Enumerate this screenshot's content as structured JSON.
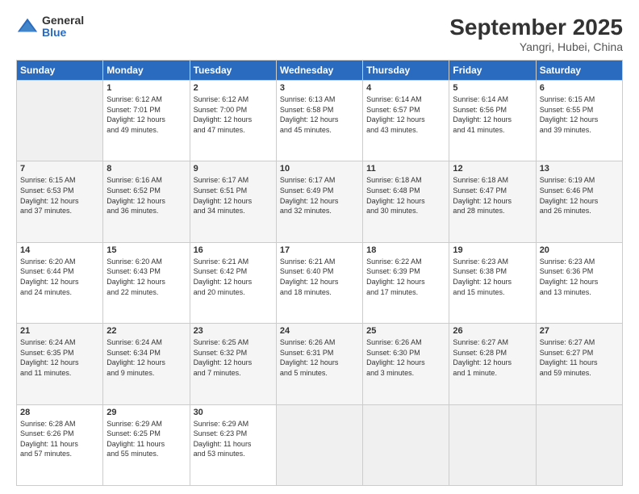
{
  "header": {
    "logo_general": "General",
    "logo_blue": "Blue",
    "month_title": "September 2025",
    "location": "Yangri, Hubei, China"
  },
  "days_of_week": [
    "Sunday",
    "Monday",
    "Tuesday",
    "Wednesday",
    "Thursday",
    "Friday",
    "Saturday"
  ],
  "weeks": [
    [
      {
        "day": "",
        "info": ""
      },
      {
        "day": "1",
        "info": "Sunrise: 6:12 AM\nSunset: 7:01 PM\nDaylight: 12 hours\nand 49 minutes."
      },
      {
        "day": "2",
        "info": "Sunrise: 6:12 AM\nSunset: 7:00 PM\nDaylight: 12 hours\nand 47 minutes."
      },
      {
        "day": "3",
        "info": "Sunrise: 6:13 AM\nSunset: 6:58 PM\nDaylight: 12 hours\nand 45 minutes."
      },
      {
        "day": "4",
        "info": "Sunrise: 6:14 AM\nSunset: 6:57 PM\nDaylight: 12 hours\nand 43 minutes."
      },
      {
        "day": "5",
        "info": "Sunrise: 6:14 AM\nSunset: 6:56 PM\nDaylight: 12 hours\nand 41 minutes."
      },
      {
        "day": "6",
        "info": "Sunrise: 6:15 AM\nSunset: 6:55 PM\nDaylight: 12 hours\nand 39 minutes."
      }
    ],
    [
      {
        "day": "7",
        "info": "Sunrise: 6:15 AM\nSunset: 6:53 PM\nDaylight: 12 hours\nand 37 minutes."
      },
      {
        "day": "8",
        "info": "Sunrise: 6:16 AM\nSunset: 6:52 PM\nDaylight: 12 hours\nand 36 minutes."
      },
      {
        "day": "9",
        "info": "Sunrise: 6:17 AM\nSunset: 6:51 PM\nDaylight: 12 hours\nand 34 minutes."
      },
      {
        "day": "10",
        "info": "Sunrise: 6:17 AM\nSunset: 6:49 PM\nDaylight: 12 hours\nand 32 minutes."
      },
      {
        "day": "11",
        "info": "Sunrise: 6:18 AM\nSunset: 6:48 PM\nDaylight: 12 hours\nand 30 minutes."
      },
      {
        "day": "12",
        "info": "Sunrise: 6:18 AM\nSunset: 6:47 PM\nDaylight: 12 hours\nand 28 minutes."
      },
      {
        "day": "13",
        "info": "Sunrise: 6:19 AM\nSunset: 6:46 PM\nDaylight: 12 hours\nand 26 minutes."
      }
    ],
    [
      {
        "day": "14",
        "info": "Sunrise: 6:20 AM\nSunset: 6:44 PM\nDaylight: 12 hours\nand 24 minutes."
      },
      {
        "day": "15",
        "info": "Sunrise: 6:20 AM\nSunset: 6:43 PM\nDaylight: 12 hours\nand 22 minutes."
      },
      {
        "day": "16",
        "info": "Sunrise: 6:21 AM\nSunset: 6:42 PM\nDaylight: 12 hours\nand 20 minutes."
      },
      {
        "day": "17",
        "info": "Sunrise: 6:21 AM\nSunset: 6:40 PM\nDaylight: 12 hours\nand 18 minutes."
      },
      {
        "day": "18",
        "info": "Sunrise: 6:22 AM\nSunset: 6:39 PM\nDaylight: 12 hours\nand 17 minutes."
      },
      {
        "day": "19",
        "info": "Sunrise: 6:23 AM\nSunset: 6:38 PM\nDaylight: 12 hours\nand 15 minutes."
      },
      {
        "day": "20",
        "info": "Sunrise: 6:23 AM\nSunset: 6:36 PM\nDaylight: 12 hours\nand 13 minutes."
      }
    ],
    [
      {
        "day": "21",
        "info": "Sunrise: 6:24 AM\nSunset: 6:35 PM\nDaylight: 12 hours\nand 11 minutes."
      },
      {
        "day": "22",
        "info": "Sunrise: 6:24 AM\nSunset: 6:34 PM\nDaylight: 12 hours\nand 9 minutes."
      },
      {
        "day": "23",
        "info": "Sunrise: 6:25 AM\nSunset: 6:32 PM\nDaylight: 12 hours\nand 7 minutes."
      },
      {
        "day": "24",
        "info": "Sunrise: 6:26 AM\nSunset: 6:31 PM\nDaylight: 12 hours\nand 5 minutes."
      },
      {
        "day": "25",
        "info": "Sunrise: 6:26 AM\nSunset: 6:30 PM\nDaylight: 12 hours\nand 3 minutes."
      },
      {
        "day": "26",
        "info": "Sunrise: 6:27 AM\nSunset: 6:28 PM\nDaylight: 12 hours\nand 1 minute."
      },
      {
        "day": "27",
        "info": "Sunrise: 6:27 AM\nSunset: 6:27 PM\nDaylight: 11 hours\nand 59 minutes."
      }
    ],
    [
      {
        "day": "28",
        "info": "Sunrise: 6:28 AM\nSunset: 6:26 PM\nDaylight: 11 hours\nand 57 minutes."
      },
      {
        "day": "29",
        "info": "Sunrise: 6:29 AM\nSunset: 6:25 PM\nDaylight: 11 hours\nand 55 minutes."
      },
      {
        "day": "30",
        "info": "Sunrise: 6:29 AM\nSunset: 6:23 PM\nDaylight: 11 hours\nand 53 minutes."
      },
      {
        "day": "",
        "info": ""
      },
      {
        "day": "",
        "info": ""
      },
      {
        "day": "",
        "info": ""
      },
      {
        "day": "",
        "info": ""
      }
    ]
  ]
}
